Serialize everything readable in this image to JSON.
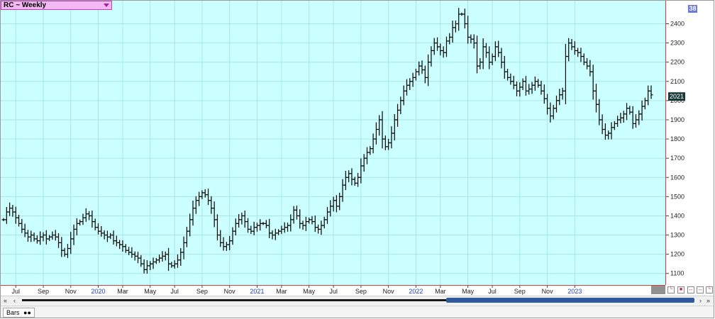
{
  "window": {
    "title": "RC ~ Weekly",
    "badge": "38"
  },
  "bottom": {
    "tab_label": "Bars"
  },
  "colors": {
    "background": "#ccffff",
    "grid": "#a8e6e6",
    "bars": "#000000",
    "axis_accent": "#d04040",
    "title_bg": "#f4b8f4",
    "scroll_thumb": "#2f5aa0",
    "last_price_box": "#1a3a3a"
  },
  "chart_data": {
    "type": "ohlc",
    "title": "RC ~ Weekly",
    "last_price_label": "2021",
    "ylim": [
      1040,
      2520
    ],
    "y_ticks": [
      1100,
      1200,
      1300,
      1400,
      1500,
      1600,
      1700,
      1800,
      1900,
      2000,
      2100,
      2200,
      2300,
      2400
    ],
    "x_tick_labels": [
      {
        "label": "Jul",
        "week": 4,
        "year_marker": false
      },
      {
        "label": "Sep",
        "week": 13,
        "year_marker": false
      },
      {
        "label": "Nov",
        "week": 22,
        "year_marker": false
      },
      {
        "label": "2020",
        "week": 31,
        "year_marker": true
      },
      {
        "label": "Mar",
        "week": 39,
        "year_marker": false
      },
      {
        "label": "May",
        "week": 48,
        "year_marker": false
      },
      {
        "label": "Jul",
        "week": 56,
        "year_marker": false
      },
      {
        "label": "Sep",
        "week": 65,
        "year_marker": false
      },
      {
        "label": "Nov",
        "week": 74,
        "year_marker": false
      },
      {
        "label": "2021",
        "week": 83,
        "year_marker": true
      },
      {
        "label": "Mar",
        "week": 91,
        "year_marker": false
      },
      {
        "label": "May",
        "week": 100,
        "year_marker": false
      },
      {
        "label": "Jul",
        "week": 108,
        "year_marker": false
      },
      {
        "label": "Sep",
        "week": 117,
        "year_marker": false
      },
      {
        "label": "Nov",
        "week": 126,
        "year_marker": false
      },
      {
        "label": "2022",
        "week": 135,
        "year_marker": true
      },
      {
        "label": "Mar",
        "week": 143,
        "year_marker": false
      },
      {
        "label": "May",
        "week": 152,
        "year_marker": false
      },
      {
        "label": "Jul",
        "week": 160,
        "year_marker": false
      },
      {
        "label": "Sep",
        "week": 169,
        "year_marker": false
      },
      {
        "label": "Nov",
        "week": 178,
        "year_marker": false
      },
      {
        "label": "2023",
        "week": 187,
        "year_marker": true
      }
    ],
    "closes": [
      1380,
      1420,
      1440,
      1420,
      1390,
      1360,
      1330,
      1310,
      1290,
      1300,
      1280,
      1270,
      1290,
      1300,
      1280,
      1290,
      1300,
      1290,
      1260,
      1220,
      1200,
      1230,
      1280,
      1330,
      1360,
      1370,
      1390,
      1410,
      1400,
      1370,
      1340,
      1320,
      1310,
      1300,
      1290,
      1300,
      1270,
      1260,
      1250,
      1240,
      1220,
      1210,
      1200,
      1190,
      1180,
      1150,
      1120,
      1140,
      1150,
      1160,
      1170,
      1180,
      1190,
      1200,
      1150,
      1140,
      1150,
      1170,
      1210,
      1260,
      1320,
      1380,
      1440,
      1480,
      1500,
      1520,
      1510,
      1480,
      1440,
      1380,
      1300,
      1260,
      1240,
      1250,
      1270,
      1320,
      1360,
      1380,
      1400,
      1370,
      1330,
      1320,
      1340,
      1350,
      1360,
      1360,
      1350,
      1310,
      1300,
      1310,
      1320,
      1330,
      1340,
      1350,
      1380,
      1430,
      1400,
      1360,
      1350,
      1370,
      1380,
      1370,
      1340,
      1330,
      1350,
      1380,
      1420,
      1450,
      1480,
      1450,
      1500,
      1560,
      1600,
      1620,
      1590,
      1570,
      1600,
      1660,
      1700,
      1730,
      1750,
      1800,
      1850,
      1900,
      1800,
      1760,
      1780,
      1830,
      1900,
      1950,
      2000,
      2050,
      2080,
      2100,
      2120,
      2150,
      2180,
      2160,
      2120,
      2200,
      2260,
      2300,
      2280,
      2260,
      2250,
      2310,
      2330,
      2380,
      2400,
      2450,
      2450,
      2400,
      2330,
      2320,
      2300,
      2180,
      2200,
      2280,
      2250,
      2200,
      2230,
      2280,
      2250,
      2200,
      2150,
      2120,
      2100,
      2080,
      2050,
      2070,
      2100,
      2050,
      2060,
      2080,
      2100,
      2080,
      2050,
      2010,
      1960,
      1920,
      1960,
      2000,
      2030,
      2050,
      2230,
      2300,
      2280,
      2260,
      2250,
      2230,
      2200,
      2180,
      2150,
      2050,
      1980,
      1900,
      1850,
      1820,
      1830,
      1860,
      1880,
      1900,
      1910,
      1930,
      1960,
      1940,
      1880,
      1900,
      1930,
      1970,
      2000,
      2050,
      2030
    ]
  }
}
